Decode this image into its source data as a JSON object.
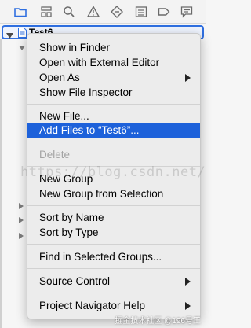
{
  "toolbar": {
    "icons": [
      "folder-icon",
      "hierarchy-icon",
      "search-icon",
      "warning-icon",
      "test-diamond-icon",
      "debug-list-icon",
      "breakpoint-icon",
      "report-icon"
    ]
  },
  "project": {
    "name": "Test6"
  },
  "menu": {
    "items": [
      {
        "label": "Show in Finder"
      },
      {
        "label": "Open with External Editor"
      },
      {
        "label": "Open As"
      },
      {
        "label": "Show File Inspector"
      },
      {
        "label": "New File..."
      },
      {
        "label": "Add Files to “Test6”..."
      },
      {
        "label": "Delete"
      },
      {
        "label": "New Group"
      },
      {
        "label": "New Group from Selection"
      },
      {
        "label": "Sort by Name"
      },
      {
        "label": "Sort by Type"
      },
      {
        "label": "Find in Selected Groups..."
      },
      {
        "label": "Source Control"
      },
      {
        "label": "Project Navigator Help"
      }
    ]
  },
  "watermark": {
    "text": "https://blog.csdn.net/",
    "credit": "掘金技术社区 @196号王"
  },
  "colors": {
    "accent": "#1d61da",
    "toolbar_active": "#2f6fe0"
  }
}
